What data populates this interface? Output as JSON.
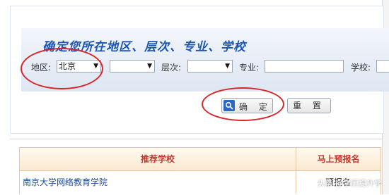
{
  "search": {
    "title": "确定您所在地区、层次、专业、学校",
    "region_label": "地区:",
    "region_value": "北京",
    "city_value": "",
    "level_label": "层次:",
    "level_value": "",
    "major_label": "专业:",
    "major_value": "",
    "school_label": "学校:",
    "school_value": "",
    "confirm_label": "确 定",
    "reset_label": "重 置"
  },
  "results": {
    "headers": [
      "推荐学校",
      "马上预报名"
    ],
    "rows": [
      {
        "school": "南京大学网络教育学院",
        "action": "预报名"
      }
    ]
  },
  "watermark": "头条 @学历提升学",
  "colors": {
    "title_blue": "#1d56b3",
    "annotation_red": "#d8262b",
    "header_red": "#c5372d",
    "link_blue": "#1d4fa0"
  },
  "icons": [
    "search-icon",
    "dropdown-arrow-icon"
  ]
}
